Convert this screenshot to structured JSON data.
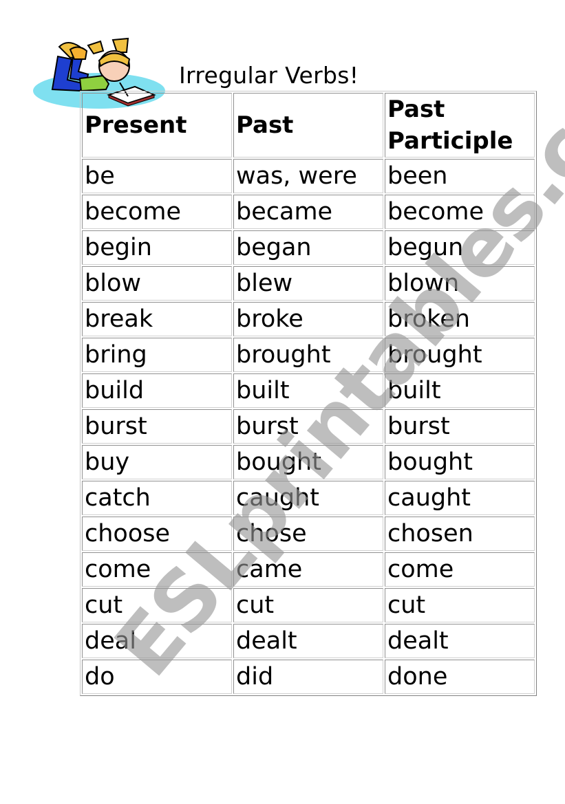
{
  "page": {
    "title": "Irregular Verbs!",
    "clipart": "girl-writing-in-book-icon",
    "watermark": "ESLprintables.com"
  },
  "table": {
    "headers": [
      "Present",
      "Past",
      "Past Participle"
    ],
    "rows": [
      [
        "be",
        "was, were",
        "been"
      ],
      [
        "become",
        "became",
        "become"
      ],
      [
        "begin",
        "began",
        "begun"
      ],
      [
        "blow",
        "blew",
        "blown"
      ],
      [
        "break",
        "broke",
        "broken"
      ],
      [
        "bring",
        "brought",
        "brought"
      ],
      [
        "build",
        "built",
        "built"
      ],
      [
        "burst",
        "burst",
        "burst"
      ],
      [
        "buy",
        "bought",
        "bought"
      ],
      [
        "catch",
        "caught",
        "caught"
      ],
      [
        "choose",
        "chose",
        "chosen"
      ],
      [
        "come",
        "came",
        "come"
      ],
      [
        "cut",
        "cut",
        "cut"
      ],
      [
        "deal",
        "dealt",
        "dealt"
      ],
      [
        "do",
        "did",
        "done"
      ]
    ]
  }
}
